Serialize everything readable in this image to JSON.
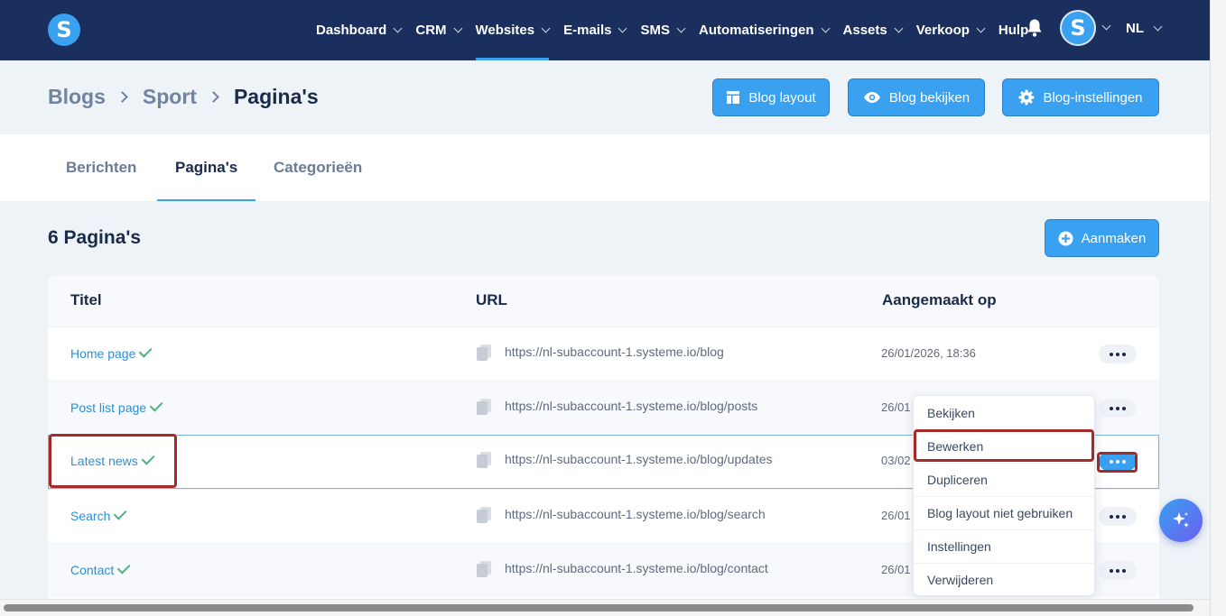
{
  "logo": "S",
  "nav": {
    "items": [
      {
        "label": "Dashboard",
        "dropdown": true
      },
      {
        "label": "CRM",
        "dropdown": true
      },
      {
        "label": "Websites",
        "dropdown": true,
        "active": true
      },
      {
        "label": "E-mails",
        "dropdown": true
      },
      {
        "label": "SMS",
        "dropdown": true
      },
      {
        "label": "Automatiseringen",
        "dropdown": true
      },
      {
        "label": "Assets",
        "dropdown": true
      },
      {
        "label": "Verkoop",
        "dropdown": true
      },
      {
        "label": "Hulp",
        "dropdown": false
      }
    ],
    "avatar": "S",
    "language": "NL"
  },
  "breadcrumb": {
    "items": [
      "Blogs",
      "Sport",
      "Pagina's"
    ]
  },
  "header_buttons": {
    "blog_layout": "Blog layout",
    "view_blog": "Blog bekijken",
    "blog_settings": "Blog-instellingen"
  },
  "tabs": [
    {
      "label": "Berichten",
      "active": false
    },
    {
      "label": "Pagina's",
      "active": true
    },
    {
      "label": "Categorieën",
      "active": false
    }
  ],
  "list": {
    "title": "6 Pagina's",
    "create_label": "Aanmaken",
    "columns": {
      "title": "Titel",
      "url": "URL",
      "created": "Aangemaakt op"
    },
    "rows": [
      {
        "title": "Home page",
        "url": "https://nl-subaccount-1.systeme.io/blog",
        "date": "26/01/2026, 18:36"
      },
      {
        "title": "Post list page",
        "url": "https://nl-subaccount-1.systeme.io/blog/posts",
        "date": "26/01"
      },
      {
        "title": "Latest news",
        "url": "https://nl-subaccount-1.systeme.io/blog/updates",
        "date": "03/02"
      },
      {
        "title": "Search",
        "url": "https://nl-subaccount-1.systeme.io/blog/search",
        "date": "26/01"
      },
      {
        "title": "Contact",
        "url": "https://nl-subaccount-1.systeme.io/blog/contact",
        "date": "26/01"
      }
    ]
  },
  "row_menu": {
    "items": [
      "Bekijken",
      "Bewerken",
      "Dupliceren",
      "Blog layout niet gebruiken",
      "Instellingen",
      "Verwijderen"
    ]
  },
  "colors": {
    "nav_bg": "#1a2f5e",
    "accent": "#3aa0f0",
    "link": "#2d8fd4",
    "check": "#4db28a",
    "highlight": "#a52a2a"
  }
}
